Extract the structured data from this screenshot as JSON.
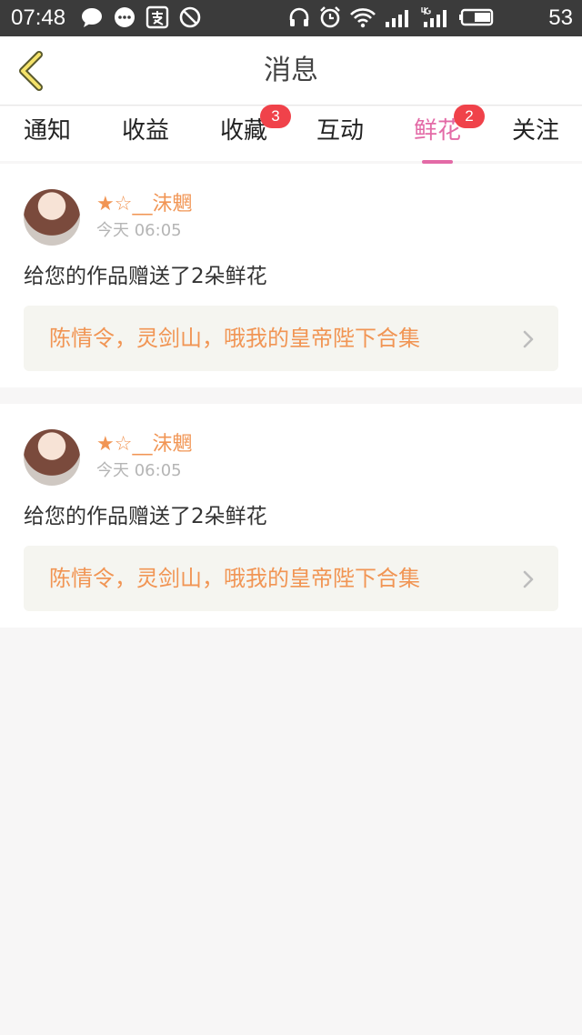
{
  "status_bar": {
    "time": "07:48",
    "battery": "53",
    "icons": [
      "chat-bubble-icon",
      "message-icon",
      "alipay-icon",
      "block-icon",
      "headphones-icon",
      "alarm-icon",
      "wifi-icon",
      "signal-icon",
      "signal-4g-icon",
      "battery-icon"
    ]
  },
  "header": {
    "title": "消息",
    "back_icon": "chevron-left-icon"
  },
  "tabs": [
    {
      "label": "通知",
      "badge": ""
    },
    {
      "label": "收益",
      "badge": ""
    },
    {
      "label": "收藏",
      "badge": "3"
    },
    {
      "label": "互动",
      "badge": ""
    },
    {
      "label": "鲜花",
      "badge": "2"
    },
    {
      "label": "关注",
      "badge": ""
    }
  ],
  "active_tab": "鲜花",
  "colors": {
    "accent": "#e36aa6",
    "badge": "#f0424a",
    "orange": "#f19554"
  },
  "messages": [
    {
      "sender": "★☆__沫魍",
      "time": "今天 06:05",
      "text": "给您的作品赠送了2朵鲜花",
      "work_title": "陈情令，灵剑山，哦我的皇帝陛下合集"
    },
    {
      "sender": "★☆__沫魍",
      "time": "今天 06:05",
      "text": "给您的作品赠送了2朵鲜花",
      "work_title": "陈情令，灵剑山，哦我的皇帝陛下合集"
    }
  ]
}
